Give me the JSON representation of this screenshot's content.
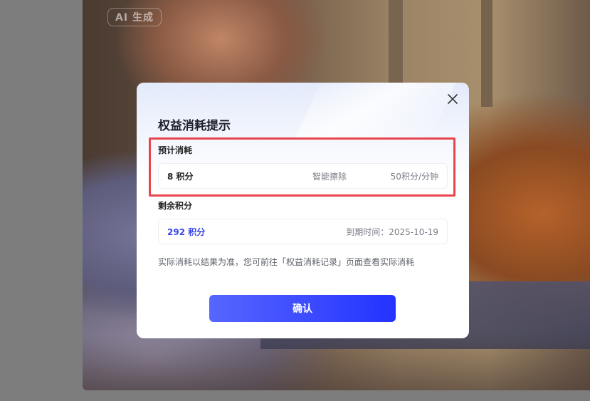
{
  "background": {
    "badge": "AI 生成"
  },
  "modal": {
    "title": "权益消耗提示",
    "estimated": {
      "label": "预计消耗",
      "amount": "8 积分",
      "feature": "智能擦除",
      "rate": "50积分/分钟"
    },
    "remaining": {
      "label": "剩余积分",
      "amount": "292 积分",
      "expiry": "到期时间：2025-10-19"
    },
    "note": "实际消耗以结果为准，您可前往「权益消耗记录」页面查看实际消耗",
    "confirm_label": "确认"
  },
  "colors": {
    "accent": "#2433ff",
    "highlight": "#e8464e",
    "remaining_amount": "#3a47e8"
  },
  "icons": {
    "close": "close-icon"
  }
}
